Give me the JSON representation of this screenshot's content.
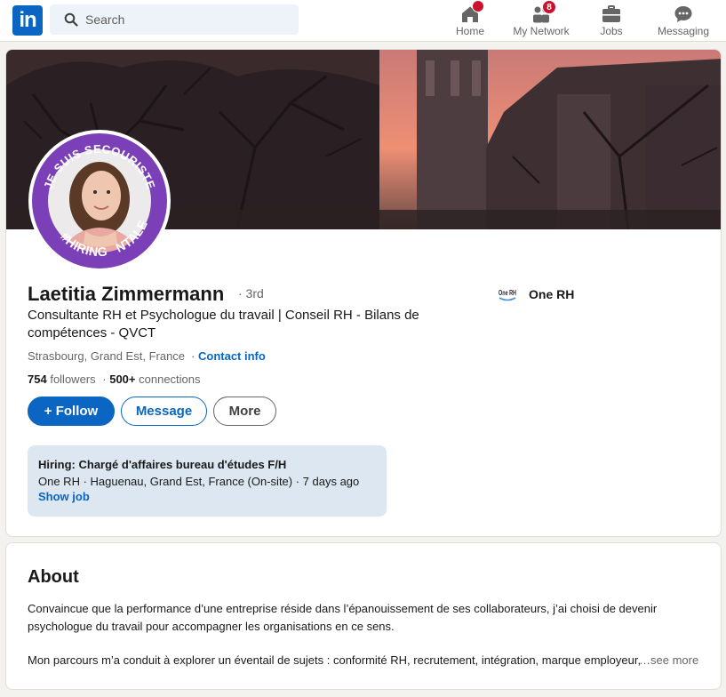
{
  "nav": {
    "logo": "in",
    "search_placeholder": "Search",
    "items": [
      {
        "label": "Home",
        "badge": ""
      },
      {
        "label": "My Network",
        "badge": "8"
      },
      {
        "label": "Jobs",
        "badge": ""
      },
      {
        "label": "Messaging",
        "badge": ""
      }
    ]
  },
  "profile": {
    "avatar_ring_text_top": "JE SUIS SECOURISTE",
    "avatar_ring_text_bottom": "#HIRING",
    "avatar_ring_text_bottom_partial": "NTALE",
    "name": "Laetitia Zimmermann",
    "degree": "· 3rd",
    "headline": "Consultante RH et Psychologue du travail | Conseil RH - Bilans de compétences - QVCT",
    "location": "Strasbourg, Grand Est, France",
    "separator": "·",
    "contact_info": "Contact info",
    "followers_count": "754",
    "followers_label": "followers",
    "connections_count": "500+",
    "connections_label": "connections",
    "company_logo_text": "One RH",
    "company": "One RH",
    "buttons": {
      "follow": "+ Follow",
      "message": "Message",
      "more": "More"
    },
    "hiring": {
      "title": "Hiring: Chargé d'affaires bureau d'études F/H",
      "meta": "One RH · Haguenau, Grand Est, France (On-site) · 7 days ago",
      "link": "Show job"
    }
  },
  "about": {
    "title": "About",
    "p1": "Convaincue que la performance d’une entreprise réside dans l’épanouissement de ses collaborateurs, j’ai choisi de devenir psychologue du travail pour accompagner les organisations en ce sens.",
    "p2": "Mon parcours m’a conduit à explorer un éventail de sujets : conformité RH, recrutement, intégration, marque employeur, formation",
    "see_more": "…see more"
  },
  "colors": {
    "brand": "#0a66c2",
    "badge": "#cb112d",
    "avatar_ring": "#7b3fb8",
    "hiring_bg": "#dde7f1"
  }
}
